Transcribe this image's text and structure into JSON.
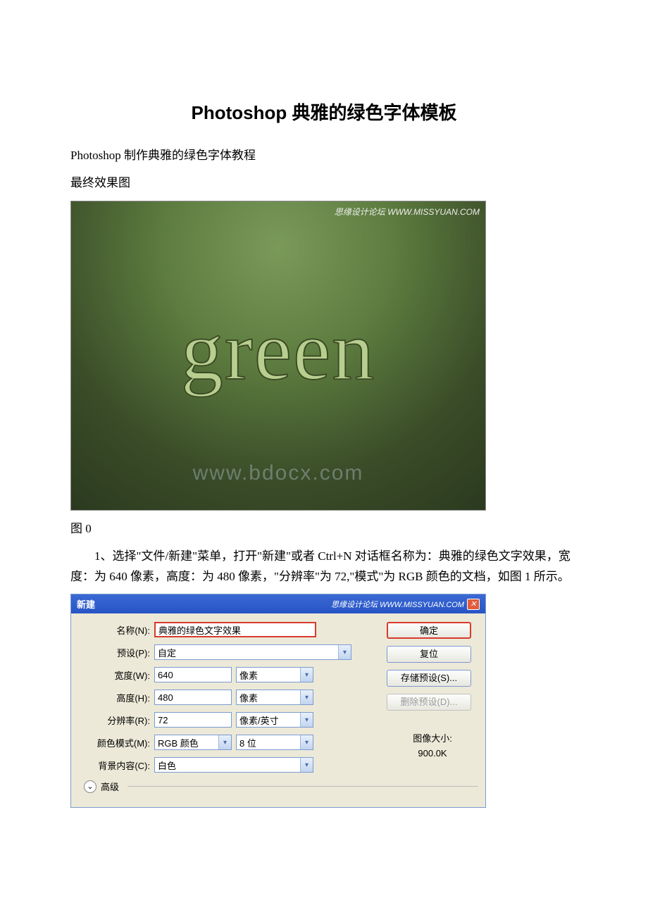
{
  "title": "Photoshop 典雅的绿色字体模板",
  "intro1": "Photoshop 制作典雅的绿色字体教程",
  "intro2": "最终效果图",
  "figure0": {
    "watermark_top": "思缘设计论坛 WWW.MISSYUAN.COM",
    "text": "green",
    "watermark_bottom": "www.bdocx.com",
    "caption": "图 0"
  },
  "step1": "1、选择\"文件/新建\"菜单，打开\"新建\"或者 Ctrl+N 对话框名称为：典雅的绿色文字效果，宽度：为 640 像素，高度：为 480 像素，\"分辨率\"为 72,\"模式\"为 RGB 颜色的文档，如图 1 所示。",
  "dialog": {
    "title": "新建",
    "watermark": "思缘设计论坛 WWW.MISSYUAN.COM",
    "labels": {
      "name": "名称(N):",
      "preset": "预设(P):",
      "width": "宽度(W):",
      "height": "高度(H):",
      "resolution": "分辨率(R):",
      "color_mode": "颜色模式(M):",
      "bg_content": "背景内容(C):"
    },
    "values": {
      "name": "典雅的绿色文字效果",
      "preset": "自定",
      "width": "640",
      "width_unit": "像素",
      "height": "480",
      "height_unit": "像素",
      "resolution": "72",
      "resolution_unit": "像素/英寸",
      "color_mode": "RGB 颜色",
      "bit_depth": "8 位",
      "bg_content": "白色"
    },
    "buttons": {
      "ok": "确定",
      "reset": "复位",
      "save_preset": "存储预设(S)...",
      "delete_preset": "删除预设(D)..."
    },
    "image_size_label": "图像大小:",
    "image_size_value": "900.0K",
    "advanced": "高级"
  }
}
